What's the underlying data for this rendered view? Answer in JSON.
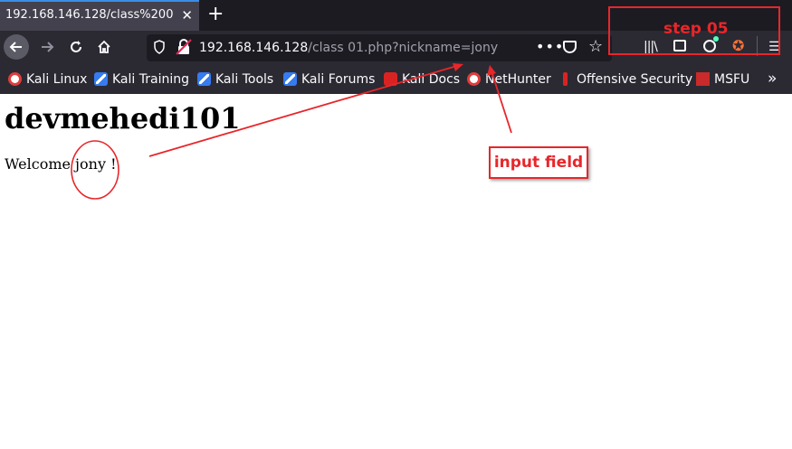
{
  "browser": {
    "tab": {
      "title": "192.168.146.128/class%200",
      "close": "✕"
    },
    "new_tab": "+",
    "url": {
      "host": "192.168.146.128",
      "path": "/class 01.php?nickname=jony"
    },
    "page_actions": "•••",
    "bookmarks": [
      {
        "label": "Kali Linux",
        "icon": "kali-icon"
      },
      {
        "label": "Kali Training",
        "icon": "kali-training-icon"
      },
      {
        "label": "Kali Tools",
        "icon": "kali-tools-icon"
      },
      {
        "label": "Kali Forums",
        "icon": "kali-forums-icon"
      },
      {
        "label": "Kali Docs",
        "icon": "kali-docs-icon"
      },
      {
        "label": "NetHunter",
        "icon": "nethunter-icon"
      },
      {
        "label": "Offensive Security",
        "icon": "offsec-icon"
      },
      {
        "label": "MSFU",
        "icon": "msfu-icon"
      }
    ],
    "bookmarks_more": "»"
  },
  "page": {
    "heading": "devmehedi101",
    "welcome_prefix": "Welcome ",
    "nickname": "jony",
    "welcome_suffix": " !"
  },
  "annotations": {
    "input_label": "input field",
    "step_label": "step 05",
    "color": "#e8262a"
  }
}
